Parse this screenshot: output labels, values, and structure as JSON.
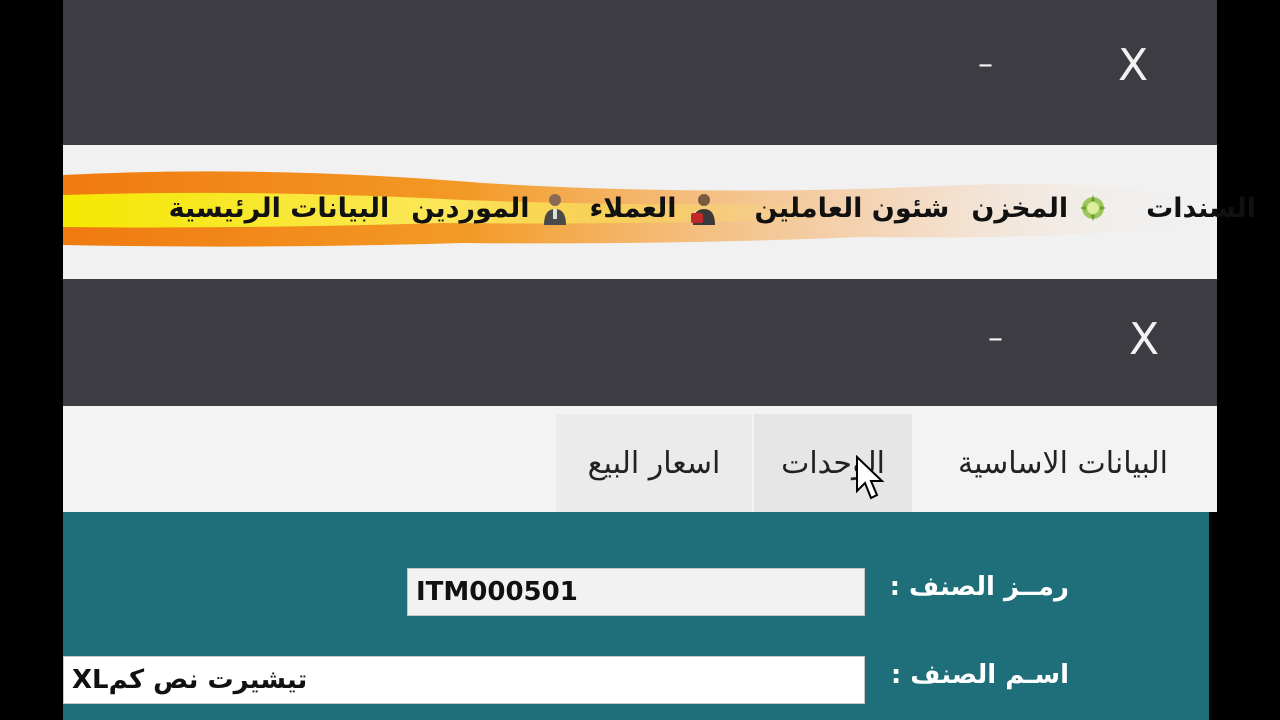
{
  "window1": {
    "close_label": "X",
    "minimize_label": "–"
  },
  "menu": {
    "items": [
      {
        "label": "البيانات الرئيسية",
        "icon": ""
      },
      {
        "label": "الموردين",
        "icon": "person-icon"
      },
      {
        "label": "العملاء",
        "icon": "customer-icon"
      },
      {
        "label": "شئون العاملين",
        "icon": ""
      },
      {
        "label": "المخزن",
        "icon": "warehouse-icon"
      },
      {
        "label": "السندات",
        "icon": ""
      }
    ]
  },
  "window2": {
    "close_label": "X",
    "minimize_label": "–"
  },
  "tabs": [
    {
      "label": "البيانات الاساسية"
    },
    {
      "label": "الوحدات"
    },
    {
      "label": "اسعار البيع"
    }
  ],
  "form": {
    "item_code_label": "رمــز الصنف :",
    "item_code_value": "ITM000501",
    "item_name_label": "اسـم الصنف :",
    "item_name_value": "تيشيرت نص كمXL"
  },
  "colors": {
    "titlebar": "#3d3c43",
    "panel": "#1f6f7a",
    "flame_orange": "#f08a1c",
    "flame_yellow": "#f7e600"
  }
}
